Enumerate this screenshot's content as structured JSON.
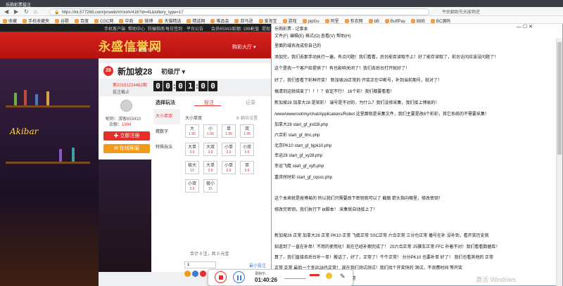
{
  "browser": {
    "tab_title": "乐购彩票投注",
    "url": "https://kk.577268.com/pcweb/#/room/416?id=41&lottery_type=17",
    "right_text": "平民翻致先天废物逆",
    "bookmarks": [
      "收藏",
      "手机收藏夹",
      "谷歌",
      "百度",
      "CGC网",
      "中商",
      "微博",
      "天猫精选",
      "精选网",
      "唯品会",
      "亚马逊",
      "爱淘宝",
      "游戏",
      "pipGu",
      "阿里",
      "布衣网",
      "bB",
      "BuffPay",
      "BBB",
      "BC源码"
    ]
  },
  "site": {
    "topstrip": {
      "phone": "手机客户端",
      "help": "帮助中心",
      "player": "防骗指南",
      "links": [
        "每日签到",
        "平台公告",
        "会员653410",
        "余额: 1994",
        "充值",
        "提现"
      ]
    },
    "logo_text": "永盛信誉网",
    "logo_sub": "HONESTY",
    "lobby": "购彩大厅",
    "lottery_number": "28",
    "lottery_name": "新加坡28",
    "lottery_mode": "初级厅",
    "issue": "第20191224462期",
    "closed_label": "投注截止",
    "timer": [
      "0",
      "0",
      "0",
      "1",
      "0",
      "0"
    ],
    "user": {
      "nickname": "昵称：游客653410",
      "balance_label": "余额：",
      "balance": "1994"
    },
    "charge_btn": "立即注册",
    "service_btn": "在线客服",
    "neon": "Akibar",
    "tabs": {
      "rules": "选择玩法",
      "bet": "投注",
      "records": "记录"
    },
    "side_menu": [
      "大小单双",
      "猜数字",
      "特殊玩法"
    ],
    "odds_header": "大小单双",
    "odds_header_right": "翻倍设置",
    "cells": [
      {
        "t": "大",
        "o": "1.95"
      },
      {
        "t": "小",
        "o": "1.95"
      },
      {
        "t": "单",
        "o": "1.95"
      },
      {
        "t": "双",
        "o": "1.95"
      },
      {
        "t": "大单",
        "o": "3.9"
      },
      {
        "t": "大双",
        "o": "3.9"
      },
      {
        "t": "小单",
        "o": "3.9"
      },
      {
        "t": "小双",
        "o": "3.9"
      },
      {
        "t": "极大",
        "o": "15"
      },
      {
        "t": "大单",
        "o": "3.9"
      },
      {
        "t": "小单",
        "o": "3.9"
      },
      {
        "t": "双",
        "o": "3.9"
      },
      {
        "t": "小双",
        "o": "3.9"
      },
      {
        "t": "极小",
        "o": "15"
      }
    ],
    "bet_count": "合计 0 注，共 0 元宝",
    "bet_amount": "1",
    "min_limit": "最小投注"
  },
  "notepad": {
    "title": "乐购彩票 - 记事本",
    "menu": [
      "文件(F)",
      "编辑(E)",
      "格式(O)",
      "查看(V)",
      "帮助(H)"
    ],
    "controls": "—   ☐   ✕",
    "lines": [
      "里面的域名改成你自己的",
      "添加完，我们去那手动执行一遍，有点问题！我们看看，后台能否读取不上！好了能存读取了，前台访问应该没问题了！",
      "这个是我一个客户给提供了！有也影响关闭了！我们去后台打开就好了！",
      "好了，我们查看下彩种开奖！ 新加坡28正常的  开奖正在中断号，补到当前期号，就对了！",
      "搞清到这就结束了！！！？肯定不行！ 16个彩！我们都要看看！",
      "新加坡28 加拿大28 是官彩！ 端号是不对的，为什么？我们没修采集，我们接上博易的！",
      "/www/wwwroot/my/chat/Applications/Robot   这里面就是采集文件，我们主要是改6个彩彩，其它系统的不需要采集！",
      "加拿大28  start_gf_jnd28.php",
      "六合彩  start_gf_6hc.php",
      "北京PK10 start_gf_bjpk10.php",
      "幸运28 start_gf_xy28.php",
      "幸运飞艇  start_gf_xyft.php",
      "重庆时时彩  start_gf_cqssc.php",
      "",
      "这个本来就是按博易的  所以我们只需要改下密钥就可以了 截图  箭头指向哪里，修改密钥！",
      "修改完密钥，我们执行下 bt脚本！  采集就自动接上了！",
      "",
      "新加坡28 正常  加拿大28  正常  PK10  正常  飞艇正常  SSC正常  六合正常   三分也正常 播号在补  没补到，看开奖历史就",
      "知道到了一直在补串！不用的使用化！现在已经补期完成了！ JS六合正常   JS赛车正常  FFC 补着不对！我们看看数据库！",
      "算了，我们直接去后台补一单！搬话了，好了，正常了！牛牛正常！ 分分PK10  也要补单 好了！  我们也看其他的 正常",
      "正常 正常  最后一个幸运28也正常！   现在我们测试测试！我们找个开奖快的  测试，不浪费时间  等开奖",
      "开奖正常！我们在测其它的彩种  这个也正常",
      "接下来，我们测试  预设功能   预设123  我们看"
    ]
  },
  "recorder": {
    "label": "录制中...",
    "time": "01:40:26"
  },
  "watermark": "激活 Windows"
}
